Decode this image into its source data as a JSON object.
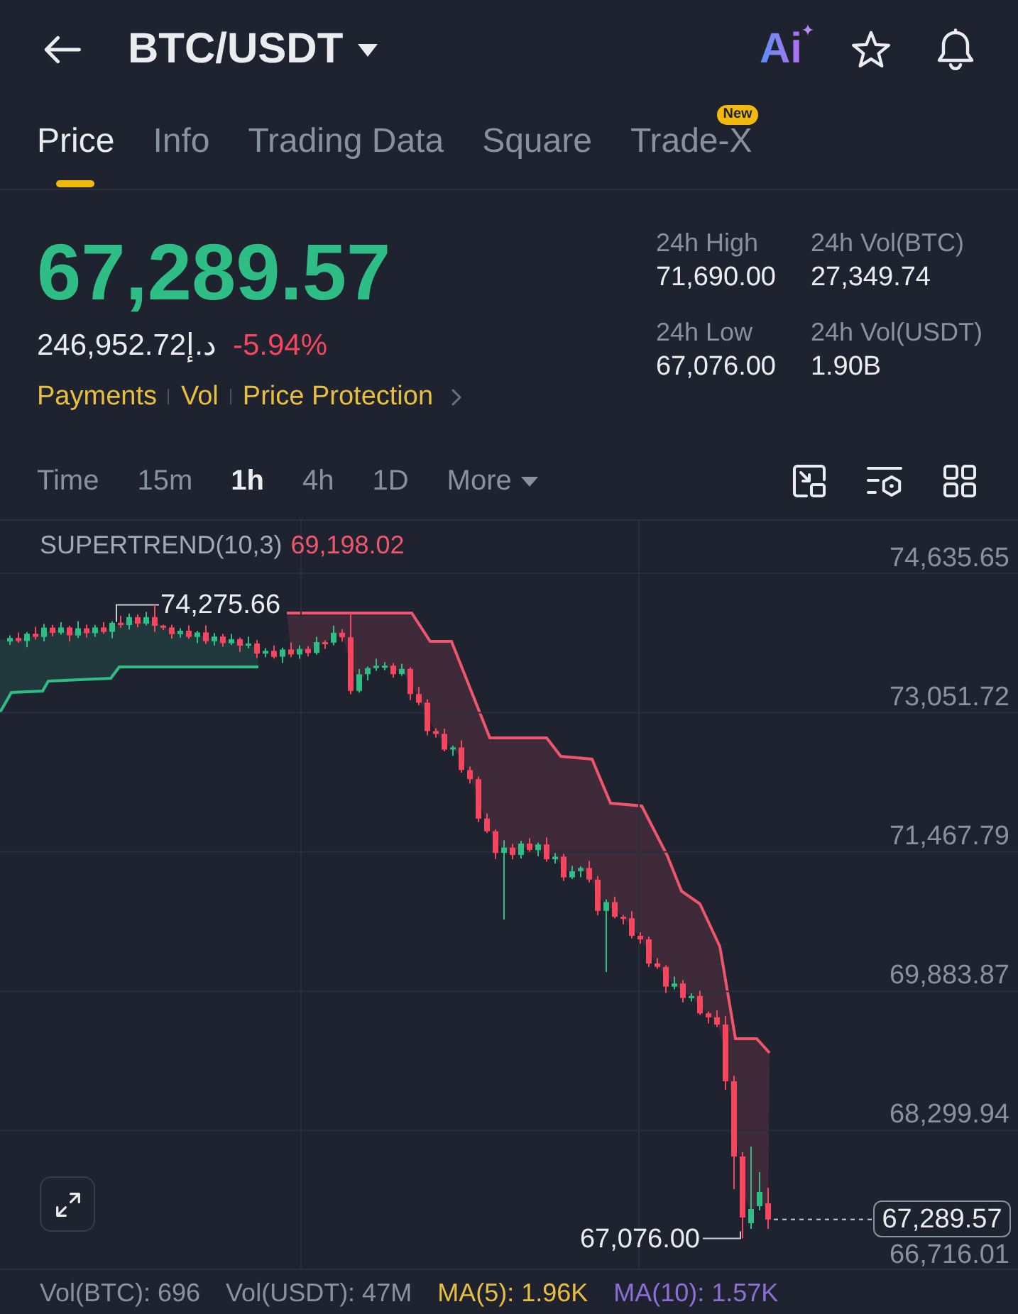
{
  "header": {
    "pair": "BTC/USDT",
    "ai_label": "Ai"
  },
  "tabs": [
    {
      "label": "Price",
      "selected": true
    },
    {
      "label": "Info",
      "selected": false
    },
    {
      "label": "Trading Data",
      "selected": false
    },
    {
      "label": "Square",
      "selected": false
    },
    {
      "label": "Trade-X",
      "selected": false,
      "badge": "New"
    }
  ],
  "ticker": {
    "last_price": "67,289.57",
    "converted_price": "246,952.72د.إ",
    "change": "-5.94%",
    "links": [
      "Payments",
      "Vol",
      "Price Protection"
    ],
    "stats": [
      {
        "label": "24h High",
        "value": "71,690.00"
      },
      {
        "label": "24h Vol(BTC)",
        "value": "27,349.74"
      },
      {
        "label": "24h Low",
        "value": "67,076.00"
      },
      {
        "label": "24h Vol(USDT)",
        "value": "1.90B"
      }
    ]
  },
  "intervals": [
    {
      "label": "Time",
      "selected": false,
      "kind": "interval"
    },
    {
      "label": "15m",
      "selected": false,
      "kind": "interval"
    },
    {
      "label": "1h",
      "selected": true,
      "kind": "interval"
    },
    {
      "label": "4h",
      "selected": false,
      "kind": "interval"
    },
    {
      "label": "1D",
      "selected": false,
      "kind": "interval"
    },
    {
      "label": "More",
      "selected": false,
      "kind": "dropdown"
    }
  ],
  "chart": {
    "indicator": {
      "name": "SUPERTREND(10,3)",
      "value": "69,198.02"
    },
    "high_label": "74,275.66",
    "low_label": "67,076.00",
    "last_price": "67,289.57",
    "chart_data": {
      "type": "candlestick",
      "grid": true,
      "ylim": [
        66716.01,
        75232.6
      ],
      "yticks": [
        {
          "value": 74635.65,
          "label": "74,635.65"
        },
        {
          "value": 73051.72,
          "label": "73,051.72"
        },
        {
          "value": 71467.79,
          "label": "71,467.79"
        },
        {
          "value": 69883.87,
          "label": "69,883.87"
        },
        {
          "value": 68299.94,
          "label": "68,299.94"
        },
        {
          "value": 66716.01,
          "label": "66,716.01"
        }
      ],
      "ohlc": [
        [
          73861,
          73931,
          73821,
          73901
        ],
        [
          73901,
          73961,
          73845,
          73865
        ],
        [
          73865,
          73968,
          73795,
          73948
        ],
        [
          73948,
          74028,
          73882,
          73912
        ],
        [
          73912,
          74058,
          73862,
          74018
        ],
        [
          74018,
          74048,
          73919,
          73959
        ],
        [
          73959,
          74079,
          73939,
          74019
        ],
        [
          74019,
          74039,
          73860,
          73930
        ],
        [
          73930,
          74090,
          73900,
          74010
        ],
        [
          74010,
          74050,
          73905,
          73955
        ],
        [
          73955,
          74049,
          73915,
          74019
        ],
        [
          74019,
          74079,
          73949,
          73969
        ],
        [
          73969,
          74093,
          73899,
          74073
        ],
        [
          74073,
          74153,
          74017,
          74047
        ],
        [
          74047,
          74178,
          73997,
          74138
        ],
        [
          74138,
          74168,
          74023,
          74063
        ],
        [
          74063,
          74198,
          74043,
          74138
        ],
        [
          74138,
          74275.66,
          73970,
          74040
        ],
        [
          74040,
          74050,
          73990,
          74020
        ],
        [
          74020,
          74050,
          73894,
          73944
        ],
        [
          73944,
          74012,
          73904,
          73982
        ],
        [
          73982,
          74042,
          73892,
          73912
        ],
        [
          73912,
          73983,
          73842,
          73963
        ],
        [
          73963,
          74043,
          73833,
          73863
        ],
        [
          73863,
          73956,
          73813,
          73916
        ],
        [
          73916,
          73946,
          73801,
          73841
        ],
        [
          73841,
          73947,
          73821,
          73887
        ],
        [
          73887,
          73907,
          73742,
          73812
        ],
        [
          73812,
          73917,
          73782,
          73837
        ],
        [
          73837,
          73877,
          73673,
          73723
        ],
        [
          73723,
          73784,
          73683,
          73754
        ],
        [
          73754,
          73814,
          73667,
          73687
        ],
        [
          73687,
          73790,
          73617,
          73770
        ],
        [
          73770,
          73850,
          73683,
          73713
        ],
        [
          73713,
          73816,
          73663,
          73776
        ],
        [
          73776,
          73806,
          73690,
          73730
        ],
        [
          73730,
          73913,
          73710,
          73853
        ],
        [
          73853,
          73873,
          73777,
          73847
        ],
        [
          73847,
          74040,
          73817,
          73960
        ],
        [
          73960,
          74000,
          73859,
          73909
        ],
        [
          73909,
          74190,
          73260,
          73300
        ],
        [
          73300,
          73548,
          73280,
          73488
        ],
        [
          73488,
          73578,
          73418,
          73558
        ],
        [
          73558,
          73664,
          73528,
          73584
        ],
        [
          73584,
          73626,
          73534,
          73586
        ],
        [
          73586,
          73616,
          73450,
          73490
        ],
        [
          73490,
          73608,
          73470,
          73548
        ],
        [
          73548,
          73568,
          73193,
          73263
        ],
        [
          73263,
          73343,
          73135,
          73165
        ],
        [
          73165,
          73205,
          72792,
          72842
        ],
        [
          72842,
          72872,
          72770,
          72810
        ],
        [
          72810,
          72870,
          72611,
          72631
        ],
        [
          72631,
          72676,
          72561,
          72656
        ],
        [
          72656,
          72736,
          72369,
          72399
        ],
        [
          72399,
          72439,
          72245,
          72295
        ],
        [
          72295,
          72325,
          71807,
          71847
        ],
        [
          71847,
          71907,
          71684,
          71704
        ],
        [
          71704,
          71724,
          71388,
          71458
        ],
        [
          71458,
          71598,
          70700,
          71518
        ],
        [
          71518,
          71558,
          71384,
          71434
        ],
        [
          71434,
          71593,
          71394,
          71563
        ],
        [
          71563,
          71623,
          71470,
          71490
        ],
        [
          71490,
          71574,
          71420,
          71554
        ],
        [
          71554,
          71634,
          71356,
          71386
        ],
        [
          71386,
          71455,
          71336,
          71415
        ],
        [
          71415,
          71445,
          71139,
          71179
        ],
        [
          71179,
          71309,
          71159,
          71249
        ],
        [
          71249,
          71305,
          71179,
          71285
        ],
        [
          71285,
          71365,
          71124,
          71154
        ],
        [
          71154,
          71194,
          70749,
          70799
        ],
        [
          70799,
          70929,
          70103,
          70899
        ],
        [
          70899,
          70959,
          70711,
          70731
        ],
        [
          70731,
          70751,
          70645,
          70715
        ],
        [
          70715,
          70795,
          70485,
          70515
        ],
        [
          70515,
          70555,
          70425,
          70475
        ],
        [
          70475,
          70505,
          70161,
          70201
        ],
        [
          70201,
          70261,
          70141,
          70161
        ],
        [
          70161,
          70181,
          69866,
          69936
        ],
        [
          69936,
          70052,
          69906,
          69972
        ],
        [
          69972,
          70012,
          69758,
          69808
        ],
        [
          69808,
          69861,
          69768,
          69831
        ],
        [
          69831,
          69891,
          69614,
          69634
        ],
        [
          69634,
          69654,
          69518,
          69588
        ],
        [
          69588,
          69668,
          69476,
          69506
        ],
        [
          69506,
          69603,
          68764,
          68861
        ],
        [
          68861,
          68925,
          67635,
          68006
        ],
        [
          68006,
          68054,
          67076.0,
          67313
        ],
        [
          67248,
          68119,
          67184,
          67409
        ],
        [
          67441,
          67829,
          67393,
          67603
        ],
        [
          67474,
          67651,
          67184,
          67289.57
        ]
      ]
    }
  },
  "volume_legend": [
    {
      "label": "Vol(BTC): 696",
      "color": "#8a919e"
    },
    {
      "label": "Vol(USDT): 47M",
      "color": "#8a919e"
    },
    {
      "label": "MA(5): 1.96K",
      "color": "#e8be3e"
    },
    {
      "label": "MA(10): 1.57K",
      "color": "#8b6fd6"
    }
  ]
}
